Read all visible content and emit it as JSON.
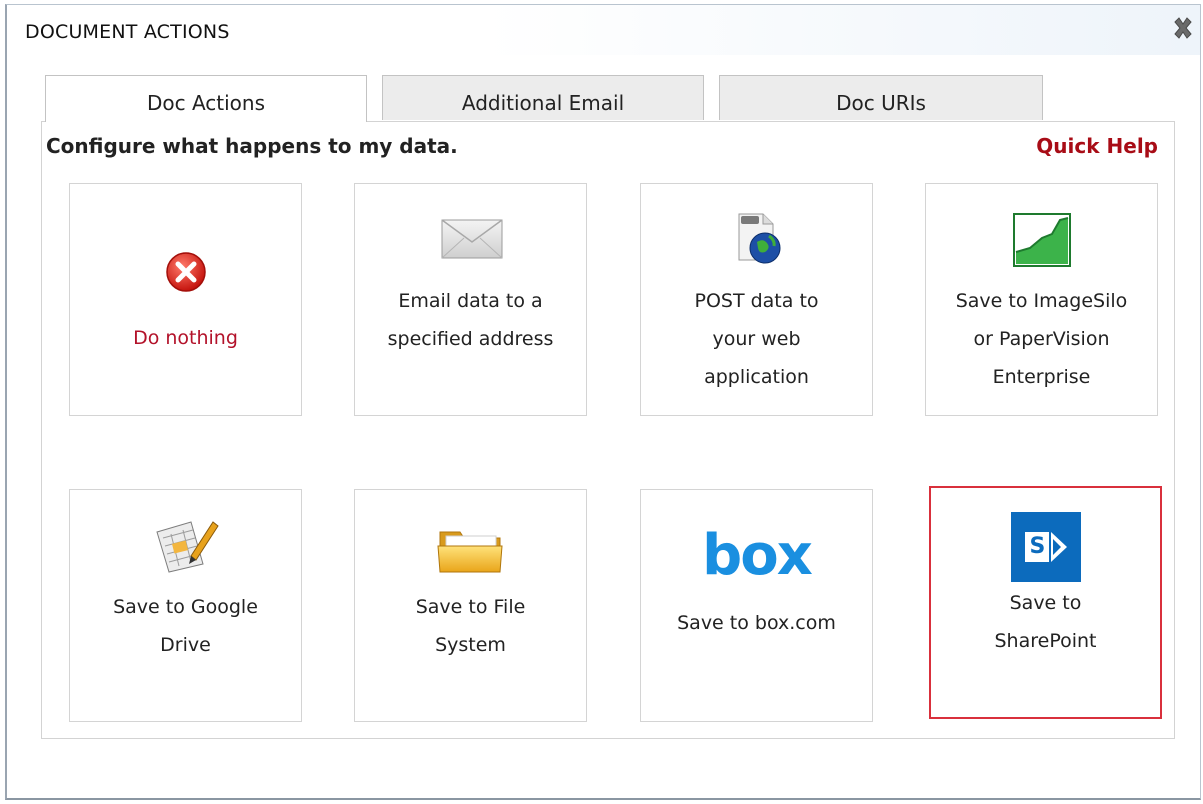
{
  "dialog": {
    "title": "DOCUMENT ACTIONS",
    "close_icon": "close-x-icon"
  },
  "tabs": [
    {
      "label": "Doc Actions",
      "active": true
    },
    {
      "label": "Additional Email",
      "active": false
    },
    {
      "label": "Doc URIs",
      "active": false
    }
  ],
  "panel": {
    "heading": "Configure what happens to my data.",
    "quick_help": "Quick Help"
  },
  "actions": [
    {
      "icon": "red-x-circle-icon",
      "lines": [
        "Do nothing"
      ],
      "selected": false
    },
    {
      "icon": "envelope-icon",
      "lines": [
        "Email data to a",
        "specified address"
      ],
      "selected": false
    },
    {
      "icon": "globe-document-icon",
      "lines": [
        "POST data to",
        "your web",
        "application"
      ],
      "selected": false
    },
    {
      "icon": "green-chart-icon",
      "lines": [
        "Save to ImageSilo",
        "or PaperVision",
        "Enterprise"
      ],
      "selected": false
    },
    {
      "icon": "spreadsheet-pencil-icon",
      "lines": [
        "Save to Google",
        "Drive"
      ],
      "selected": false
    },
    {
      "icon": "folder-icon",
      "lines": [
        "Save to File",
        "System"
      ],
      "selected": false
    },
    {
      "icon": "box-logo-icon",
      "logo_text": "box",
      "lines": [
        "Save to box.com"
      ],
      "selected": false
    },
    {
      "icon": "sharepoint-icon",
      "logo_text": "S",
      "lines": [
        "Save to",
        "SharePoint"
      ],
      "selected": true
    }
  ],
  "colors": {
    "accent_red": "#a80c16",
    "selected_border": "#d9303c",
    "box_blue": "#1a8fe0",
    "sharepoint_blue": "#0c6bbd"
  }
}
